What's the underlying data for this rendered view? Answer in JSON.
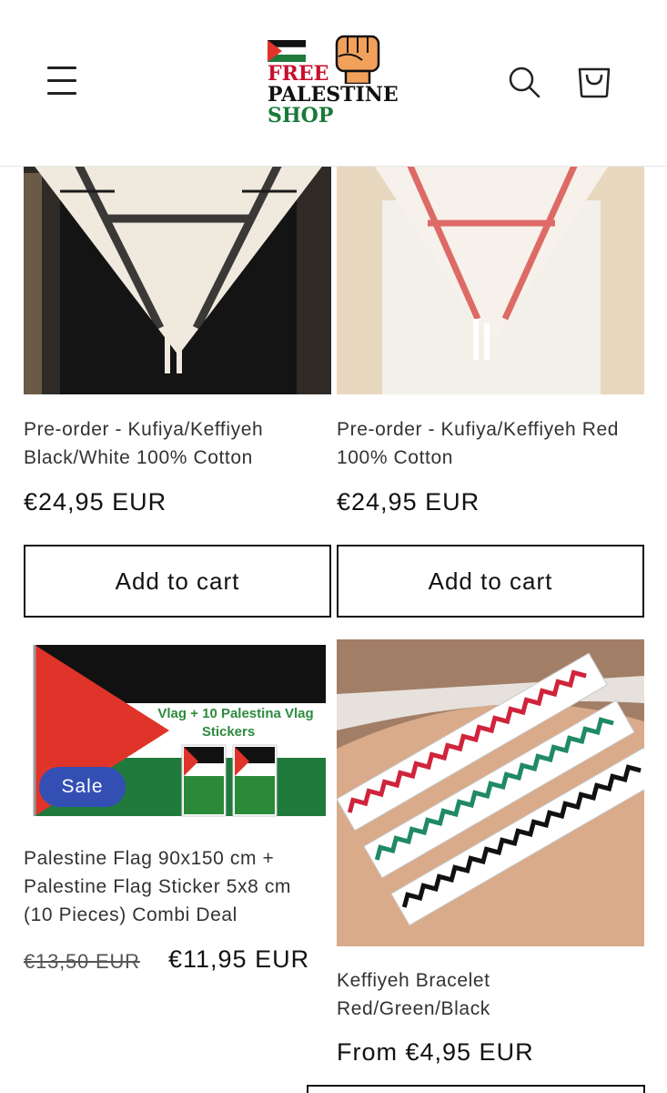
{
  "header": {
    "logo": {
      "line1": "FREE",
      "line2": "PALESTINE",
      "line3": "SHOP"
    }
  },
  "products": [
    {
      "title": "Pre-order - Kufiya/Keffiyeh Black/White 100% Cotton",
      "price": "€24,95 EUR",
      "button": "Add to cart"
    },
    {
      "title": "Pre-order - Kufiya/Keffiyeh Red 100% Cotton",
      "price": "€24,95 EUR",
      "button": "Add to cart"
    },
    {
      "title": "Palestine Flag 90x150 cm + Palestine Flag Sticker 5x8 cm (10 Pieces) Combi Deal",
      "price_old": "€13,50 EUR",
      "price": "€11,95 EUR",
      "badge": "Sale",
      "image_text_line1": "Vlag + 10 Palestina Vlag",
      "image_text_line2": "Stickers"
    },
    {
      "title": "Keffiyeh Bracelet Red/Green/Black",
      "price": "From €4,95 EUR"
    }
  ],
  "colors": {
    "flag_red": "#e0342a",
    "flag_green": "#1f7a3c",
    "badge_blue": "#334fb4",
    "logo_red": "#c8102e",
    "logo_green": "#1a7a3a"
  }
}
